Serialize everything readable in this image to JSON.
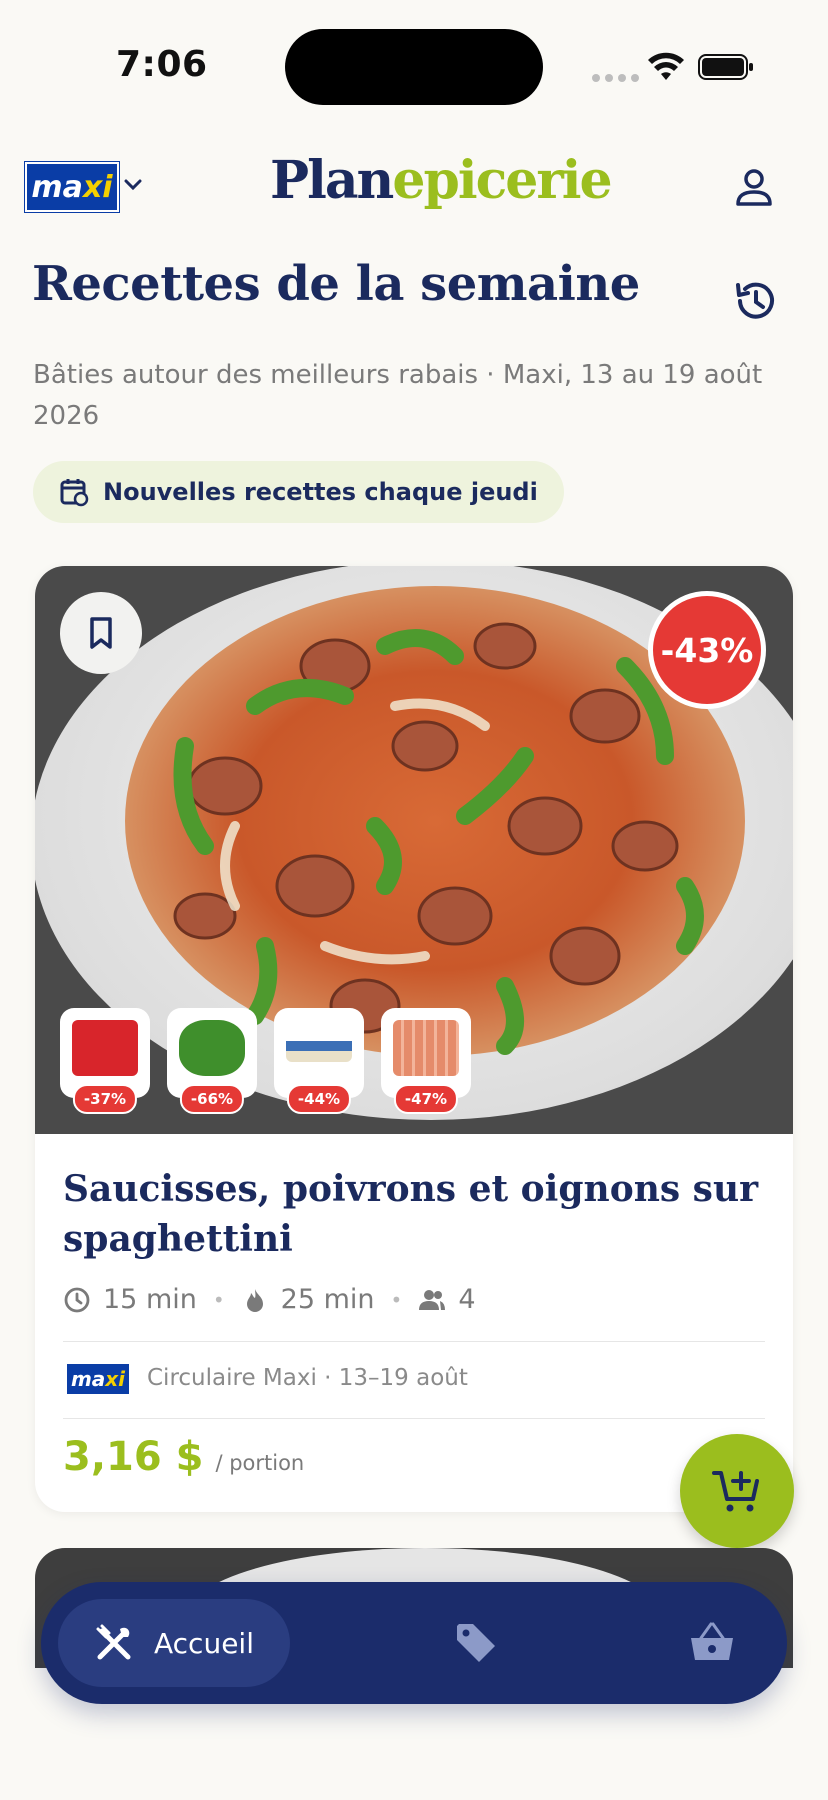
{
  "status_bar": {
    "time": "7:06"
  },
  "header": {
    "store_logo_main": "ma",
    "store_logo_accent": "xi",
    "brand_part1": "Plan",
    "brand_part2": "e",
    "brand_part3": "picerie"
  },
  "page": {
    "title": "Recettes de la semaine",
    "subtitle": "Bâties autour des meilleurs rabais · Maxi, 13 au 19 août 2026",
    "pill_label": "Nouvelles recettes chaque jeudi"
  },
  "recipe": {
    "discount_badge": "-43%",
    "ingredients": [
      {
        "discount": "-37%",
        "color": "#D8252B"
      },
      {
        "discount": "-66%",
        "color": "#3F8F2C"
      },
      {
        "discount": "-44%",
        "color": "#3B6FB6"
      },
      {
        "discount": "-47%",
        "color": "#E58B6A"
      }
    ],
    "name": "Saucisses, poivrons et oignons sur spaghettini",
    "prep_time": "15 min",
    "cook_time": "25 min",
    "servings": "4",
    "source_logo_main": "ma",
    "source_logo_accent": "xi",
    "source_text": "Circulaire Maxi · 13–19 août",
    "price": "3,16 $",
    "price_unit": "/ portion"
  },
  "nav": {
    "home_label": "Accueil"
  },
  "colors": {
    "navy": "#1B2A5E",
    "accent_green": "#9BBE1E",
    "discount_red": "#E53935",
    "maxi_blue": "#0A3DA6"
  }
}
